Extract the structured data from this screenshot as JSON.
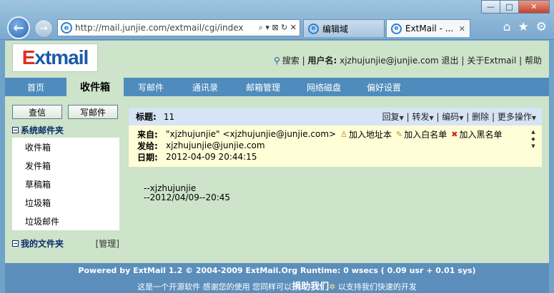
{
  "browser": {
    "url": "http://mail.junjie.com/extmail/cgi/index",
    "url_tools": "⌕ ▾ ⊠ ↻ ✕",
    "tabs": [
      {
        "label": "编辑域"
      },
      {
        "label": "ExtMail - ...",
        "close": "✕"
      }
    ],
    "window_buttons": [
      "—",
      "□",
      "✕"
    ],
    "back_glyph": "←",
    "forward_glyph": "→",
    "right_icons": [
      "home-icon",
      "star-icon",
      "gear-icon"
    ]
  },
  "header": {
    "logo_e": "E",
    "logo_rest": "xtmail",
    "search_label": "搜索",
    "username_label": "用户名:",
    "username": "xjzhujunjie@junjie.com",
    "logout": "退出",
    "about": "关于Extmail",
    "help": "帮助"
  },
  "menu": [
    {
      "label": "首页"
    },
    {
      "label": "收件箱",
      "active": true
    },
    {
      "label": "写邮件"
    },
    {
      "label": "通讯录"
    },
    {
      "label": "邮箱管理"
    },
    {
      "label": "网络磁盘"
    },
    {
      "label": "偏好设置"
    }
  ],
  "sidebar": {
    "check_button": "查信",
    "compose_button": "写邮件",
    "system_folders_title": "系统邮件夹",
    "folders": [
      "收件箱",
      "发件箱",
      "草稿箱",
      "垃圾箱",
      "垃圾邮件"
    ],
    "my_folders_title": "我的文件夹",
    "manage_label": "[管理]"
  },
  "message": {
    "subject_label": "标题:",
    "subject": "11",
    "actions": [
      "回复",
      "转发",
      "编码",
      "删除",
      "更多操作"
    ],
    "from_label": "来自:",
    "from": "\"xjzhujunjie\" <xjzhujunjie@junjie.com>",
    "add_addressbook": "加入地址本",
    "add_whitelist": "加入白名单",
    "add_blacklist": "加入黑名单",
    "to_label": "发给:",
    "to": "xjzhujunjie@junjie.com",
    "date_label": "日期:",
    "date": "2012-04-09 20:44:15",
    "body_line1": "--xjzhujunjie",
    "body_line2": "--2012/04/09--20:45"
  },
  "footer": {
    "line1": "Powered by ExtMail 1.2 © 2004-2009 ExtMail.Org Runtime: 0 wsecs ( 0.09 usr + 0.01 sys)",
    "line2_pre": "这是一个开源软件 感谢您的使用 您同样可以",
    "donate": "捐助我们",
    "line2_post": " 以支持我们快速的开发"
  }
}
